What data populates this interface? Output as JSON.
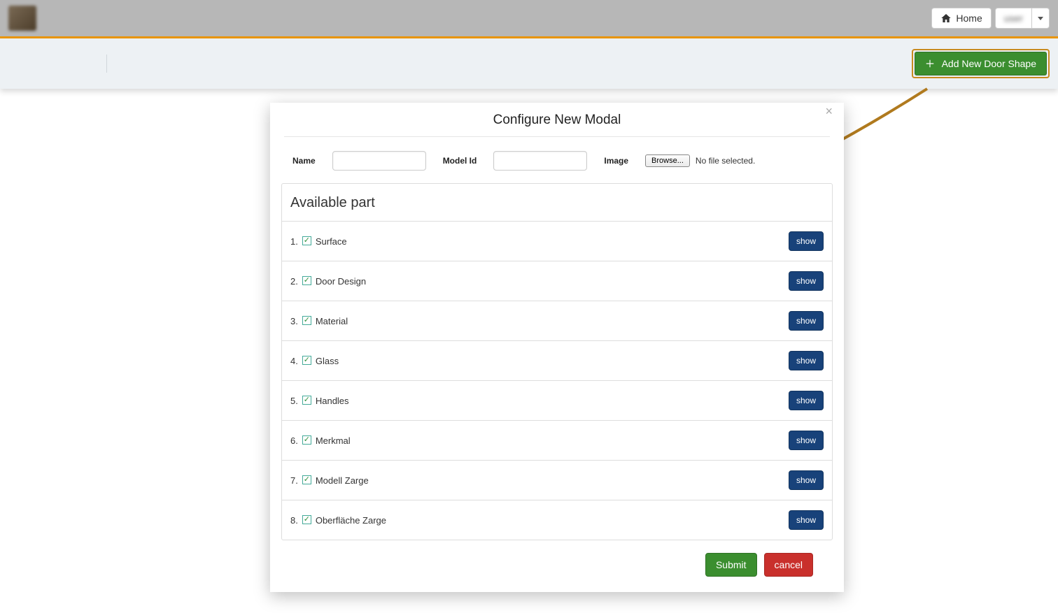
{
  "topbar": {
    "home_label": "Home",
    "user_label": "user"
  },
  "subheader": {
    "add_btn_label": "Add New Door Shape"
  },
  "modal": {
    "title": "Configure New Modal",
    "name_label": "Name",
    "modelid_label": "Model Id",
    "image_label": "Image",
    "browse_label": "Browse...",
    "file_status": "No file selected.",
    "parts_title": "Available part",
    "show_label": "show",
    "submit_label": "Submit",
    "cancel_label": "cancel",
    "parts": [
      {
        "num": "1.",
        "label": "Surface",
        "checked": true
      },
      {
        "num": "2.",
        "label": "Door Design",
        "checked": true
      },
      {
        "num": "3.",
        "label": "Material",
        "checked": true
      },
      {
        "num": "4.",
        "label": "Glass",
        "checked": true
      },
      {
        "num": "5.",
        "label": "Handles",
        "checked": true
      },
      {
        "num": "6.",
        "label": "Merkmal",
        "checked": true
      },
      {
        "num": "7.",
        "label": "Modell Zarge",
        "checked": true
      },
      {
        "num": "8.",
        "label": "Oberfläche Zarge",
        "checked": true
      }
    ]
  }
}
